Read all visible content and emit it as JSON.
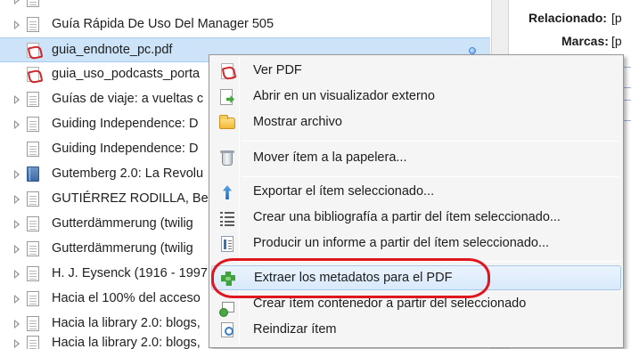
{
  "items": [
    {
      "title": "Guía Rápida De Uso Del Manager 505",
      "kind": "doc",
      "expandable": true,
      "selected": false
    },
    {
      "title": "guia_endnote_pc.pdf",
      "kind": "pdf",
      "expandable": false,
      "selected": true
    },
    {
      "title": "guia_uso_podcasts_porta",
      "kind": "pdf",
      "expandable": false,
      "selected": false
    },
    {
      "title": "Guías de viaje: a vueltas c",
      "kind": "doc",
      "expandable": true,
      "selected": false
    },
    {
      "title": "Guiding Independence: D",
      "kind": "doc",
      "expandable": true,
      "selected": false
    },
    {
      "title": "Guiding Independence: D",
      "kind": "doc",
      "expandable": false,
      "selected": false
    },
    {
      "title": "Gutemberg 2.0: La Revolu",
      "kind": "book",
      "expandable": true,
      "selected": false
    },
    {
      "title": "GUTIÉRREZ RODILLA, Ber",
      "kind": "doc",
      "expandable": true,
      "selected": false
    },
    {
      "title": "Gutterdämmerung (twilig",
      "kind": "doc",
      "expandable": true,
      "selected": false
    },
    {
      "title": "Gutterdämmerung (twilig",
      "kind": "doc",
      "expandable": true,
      "selected": false
    },
    {
      "title": "H. J. Eysenck (1916 - 1997",
      "kind": "doc",
      "expandable": true,
      "selected": false
    },
    {
      "title": "Hacia el 100% del acceso",
      "kind": "doc",
      "expandable": true,
      "selected": false
    },
    {
      "title": "Hacia la library 2.0: blogs,",
      "kind": "doc",
      "expandable": true,
      "selected": false
    },
    {
      "title": "Hacia la library 2.0: blogs,",
      "kind": "doc",
      "expandable": true,
      "selected": false
    }
  ],
  "info_pane": {
    "related_label": "Relacionado:",
    "related_value": "[p",
    "tags_label": "Marcas:",
    "tags_value": "[p"
  },
  "context_menu": {
    "items": [
      {
        "label": "Ver PDF",
        "icon": "pdf-icon"
      },
      {
        "label": "Abrir en un visualizador externo",
        "icon": "external-viewer-icon"
      },
      {
        "label": "Mostrar archivo",
        "icon": "folder-icon"
      },
      {
        "label": "Mover ítem a la papelera...",
        "icon": "trash-icon"
      },
      {
        "label": "Exportar el ítem seleccionado...",
        "icon": "export-icon"
      },
      {
        "label": "Crear una bibliografía a partir del ítem seleccionado...",
        "icon": "bibliography-icon"
      },
      {
        "label": "Producir un informe a partir del ítem seleccionado...",
        "icon": "report-icon"
      },
      {
        "label": "Extraer los metadatos para el PDF",
        "icon": "puzzle-icon",
        "highlighted": true
      },
      {
        "label": "Crear ítem contenedor a partir del seleccionado",
        "icon": "parent-item-icon"
      },
      {
        "label": "Reindizar ítem",
        "icon": "reindex-icon"
      }
    ]
  },
  "colors": {
    "selection": "#cde3f8",
    "menu_background": "#f5f5f5",
    "annotation": "#e0161f",
    "highlight_border": "#a8c9ee"
  }
}
